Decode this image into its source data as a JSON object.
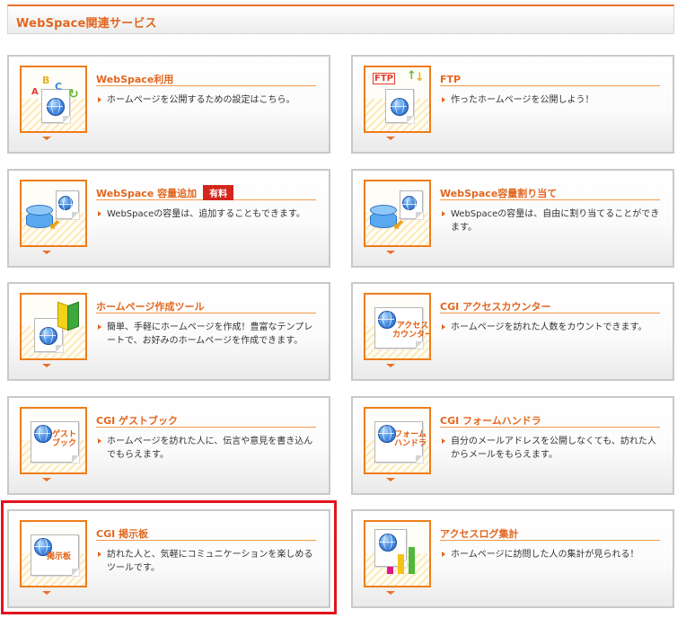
{
  "header": {
    "title": "WebSpace関連サービス"
  },
  "cards": [
    {
      "title": "WebSpace利用",
      "badge": "",
      "desc": "ホームページを公開するための設定はこちら。",
      "icon": "abc-globe-icon"
    },
    {
      "title": "FTP",
      "badge": "",
      "desc": "作ったホームページを公開しよう！",
      "icon": "ftp-upload-icon"
    },
    {
      "title": "WebSpace 容量追加",
      "badge": "有料",
      "desc": "WebSpaceの容量は、追加することもできます。",
      "icon": "storage-add-icon"
    },
    {
      "title": "WebSpace容量割り当て",
      "badge": "",
      "desc": "WebSpaceの容量は、自由に割り当てることができます。",
      "icon": "storage-assign-icon"
    },
    {
      "title": "ホームページ作成ツール",
      "badge": "",
      "desc": "簡単、手軽にホームページを作成！豊富なテンプレートで、お好みのホームページを作成できます。",
      "icon": "beginner-mark-icon"
    },
    {
      "title": "CGI アクセスカウンター",
      "badge": "",
      "desc": "ホームページを訪れた人数をカウントできます。",
      "icon": "access-counter-icon",
      "icon_text": "アクセス\nカウンター"
    },
    {
      "title": "CGI ゲストブック",
      "badge": "",
      "desc": "ホームページを訪れた人に、伝言や意見を書き込んでもらえます。",
      "icon": "guestbook-icon",
      "icon_text": "ゲスト\nブック"
    },
    {
      "title": "CGI フォームハンドラ",
      "badge": "",
      "desc": "自分のメールアドレスを公開しなくても、訪れた人からメールをもらえます。",
      "icon": "form-handler-icon",
      "icon_text": "フォーム\nハンドラ"
    },
    {
      "title": "CGI 掲示板",
      "badge": "",
      "desc": "訪れた人と、気軽にコミュニケーションを楽しめるツールです。",
      "icon": "bbs-icon",
      "icon_text": "掲示板"
    },
    {
      "title": "アクセスログ集計",
      "badge": "",
      "desc": "ホームページに訪問した人の集計が見られる！",
      "icon": "bar-chart-icon"
    }
  ],
  "colors": {
    "accent": "#e2661f",
    "badge": "#d4261c",
    "highlight": "#e0141e"
  }
}
